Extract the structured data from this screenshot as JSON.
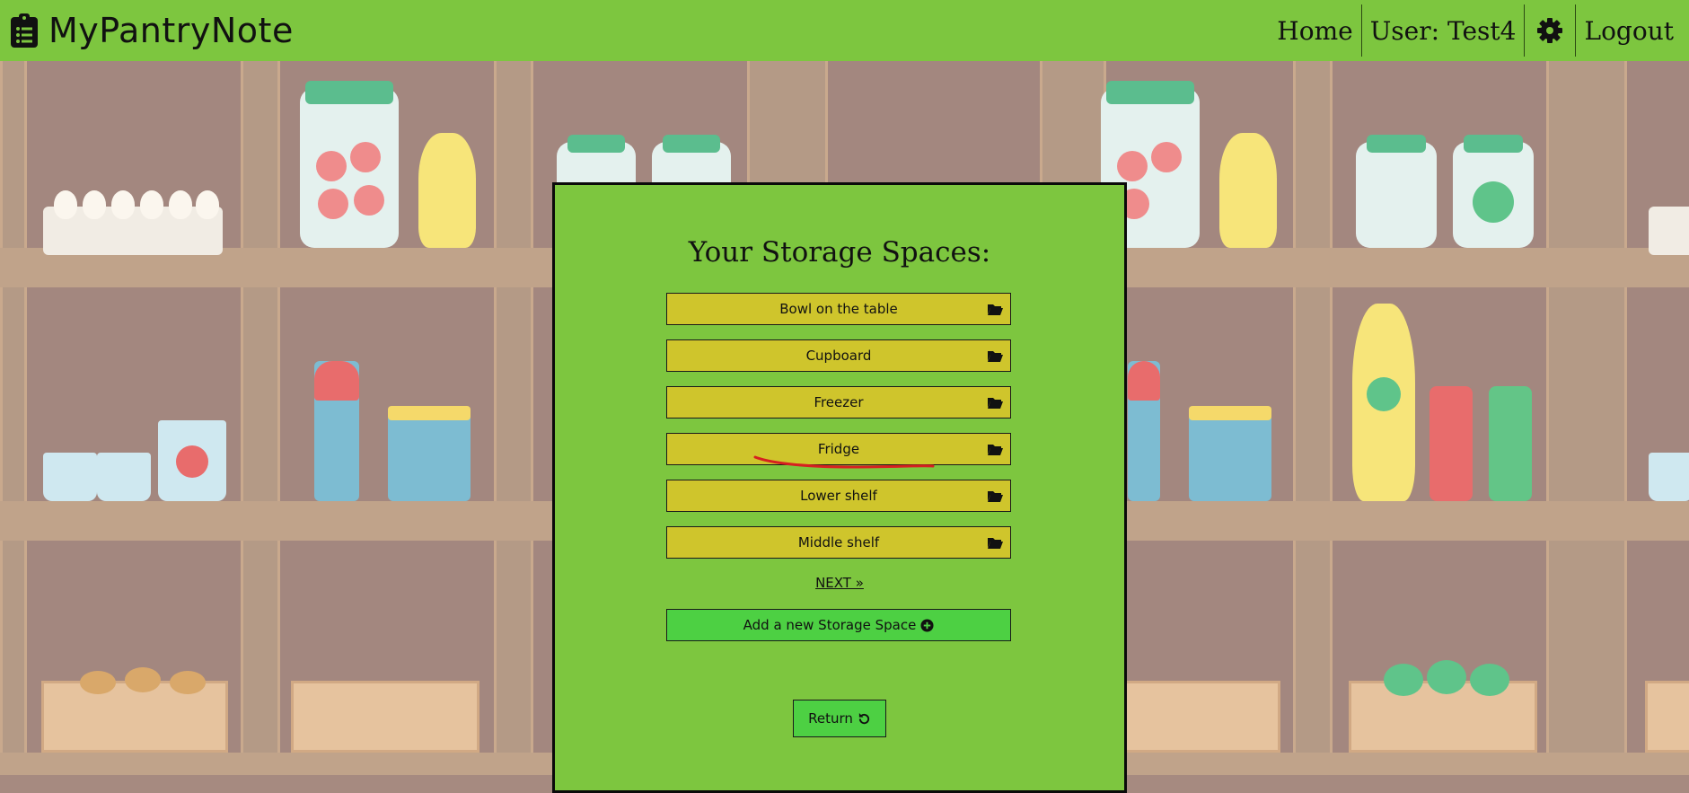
{
  "navbar": {
    "brand_title": "MyPantryNote",
    "brand_icon": "clipboard-list-icon",
    "home_label": "Home",
    "user_label": "User: Test4",
    "settings_icon": "gear-icon",
    "logout_label": "Logout",
    "bg_color": "#7dc63f"
  },
  "panel": {
    "title": "Your Storage Spaces:",
    "storage_spaces": [
      {
        "label": "Bowl on the table",
        "icon": "folder-open-icon"
      },
      {
        "label": "Cupboard",
        "icon": "folder-open-icon"
      },
      {
        "label": "Freezer",
        "icon": "folder-open-icon"
      },
      {
        "label": "Fridge",
        "icon": "folder-open-icon"
      },
      {
        "label": "Lower shelf",
        "icon": "folder-open-icon"
      },
      {
        "label": "Middle shelf",
        "icon": "folder-open-icon"
      }
    ],
    "next_label": "NEXT »",
    "add_label": "Add a new Storage Space",
    "add_icon": "plus-circle-icon",
    "return_label": "Return",
    "return_icon": "undo-icon",
    "button_color": "#cfc52c",
    "add_color": "#4dd043"
  },
  "annotation": {
    "type": "red-underline",
    "target": "Fridge",
    "color": "#d62020"
  }
}
